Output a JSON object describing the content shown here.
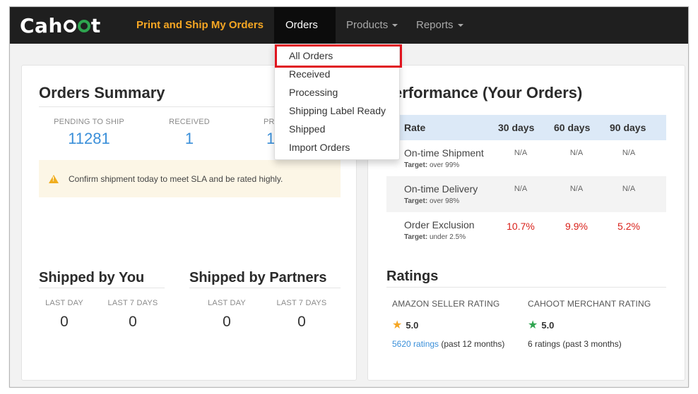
{
  "nav": {
    "logo": "Cahoot",
    "print_ship": "Print and Ship My Orders",
    "orders": "Orders",
    "products": "Products",
    "reports": "Reports"
  },
  "orders_menu": {
    "items": [
      "All Orders",
      "Received",
      "Processing",
      "Shipping Label Ready",
      "Shipped",
      "Import Orders"
    ]
  },
  "summary": {
    "title": "Orders Summary",
    "stats": [
      {
        "label": "PENDING TO SHIP",
        "value": "11281"
      },
      {
        "label": "RECEIVED",
        "value": "1"
      },
      {
        "label": "PR",
        "value": "1"
      }
    ],
    "alert": "Confirm shipment today to meet SLA and be rated highly."
  },
  "shipped_by_you": {
    "title": "Shipped by You",
    "cols": [
      {
        "label": "LAST DAY",
        "value": "0"
      },
      {
        "label": "LAST 7 DAYS",
        "value": "0"
      }
    ]
  },
  "shipped_by_partners": {
    "title": "Shipped by Partners",
    "cols": [
      {
        "label": "LAST DAY",
        "value": "0"
      },
      {
        "label": "LAST 7 DAYS",
        "value": "0"
      }
    ]
  },
  "performance": {
    "title": "erformance (Your Orders)",
    "headers": [
      "Rate",
      "30 days",
      "60 days",
      "90 days"
    ],
    "rows": [
      {
        "name": "On-time Shipment",
        "target_label": "Target:",
        "target": "over 99%",
        "values": [
          "N/A",
          "N/A",
          "N/A"
        ]
      },
      {
        "name": "On-time Delivery",
        "target_label": "Target:",
        "target": "over 98%",
        "values": [
          "N/A",
          "N/A",
          "N/A"
        ]
      },
      {
        "name": "Order Exclusion",
        "target_label": "Target:",
        "target": "under 2.5%",
        "values": [
          "10.7%",
          "9.9%",
          "5.2%"
        ]
      }
    ]
  },
  "ratings": {
    "title": "Ratings",
    "amazon": {
      "label": "AMAZON SELLER RATING",
      "value": "5.0",
      "link": "5620 ratings",
      "note": "(past 12 months)",
      "star_color": "#f5a623"
    },
    "cahoot": {
      "label": "CAHOOT MERCHANT RATING",
      "value": "5.0",
      "note": "6 ratings (past 3 months)",
      "star_color": "#2ea44f"
    }
  }
}
